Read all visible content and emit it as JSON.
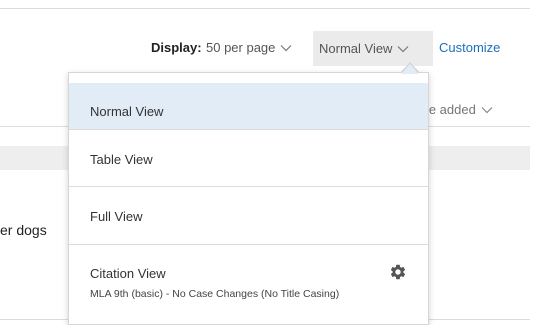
{
  "toolbar": {
    "display_label": "Display:",
    "per_page_label": "50 per page",
    "view_label": "Normal View",
    "customize_label": "Customize"
  },
  "sort": {
    "label": "ate added"
  },
  "results": {
    "partial_title": "er dogs"
  },
  "view_menu": {
    "options": [
      {
        "label": "Normal View",
        "selected": true
      },
      {
        "label": "Table View"
      },
      {
        "label": "Full View"
      },
      {
        "label": "Citation View",
        "sublabel": "MLA 9th (basic) - No Case Changes (No Title Casing)",
        "icon": "gear-icon"
      }
    ]
  },
  "colors": {
    "accent_link": "#1a6fb9",
    "selected_bg": "#e1ecf7",
    "select_bg": "#ebebeb"
  }
}
